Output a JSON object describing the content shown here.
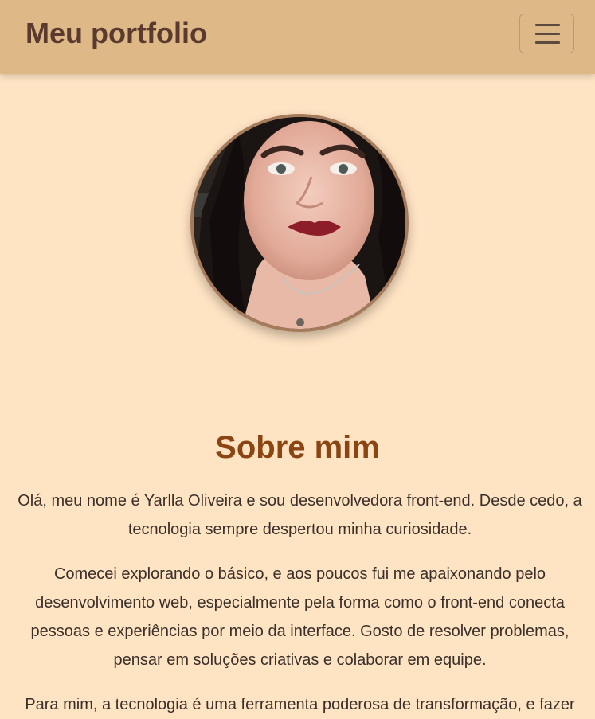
{
  "navbar": {
    "brand": "Meu portfolio",
    "toggle_icon": "menu-icon"
  },
  "profile": {
    "photo_alt": "profile-photo"
  },
  "about": {
    "title": "Sobre mim",
    "paragraphs": [
      "Olá, meu nome é Yarlla Oliveira e sou desenvolvedora front-end. Desde cedo, a tecnologia sempre despertou minha curiosidade.",
      "Comecei explorando o básico, e aos poucos fui me apaixonando pelo desenvolvimento web, especialmente pela forma como o front-end conecta pessoas e experiências por meio da interface. Gosto de resolver problemas, pensar em soluções criativas e colaborar em equipe.",
      "Para mim, a tecnologia é uma ferramenta poderosa de transformação, e fazer"
    ]
  },
  "colors": {
    "background": "#ffe4c4",
    "navbar": "#deb887",
    "brand_text": "#5a3a2e",
    "title": "#8b4513",
    "body_text": "#3b2f2a",
    "avatar_border": "#a67b5b"
  }
}
